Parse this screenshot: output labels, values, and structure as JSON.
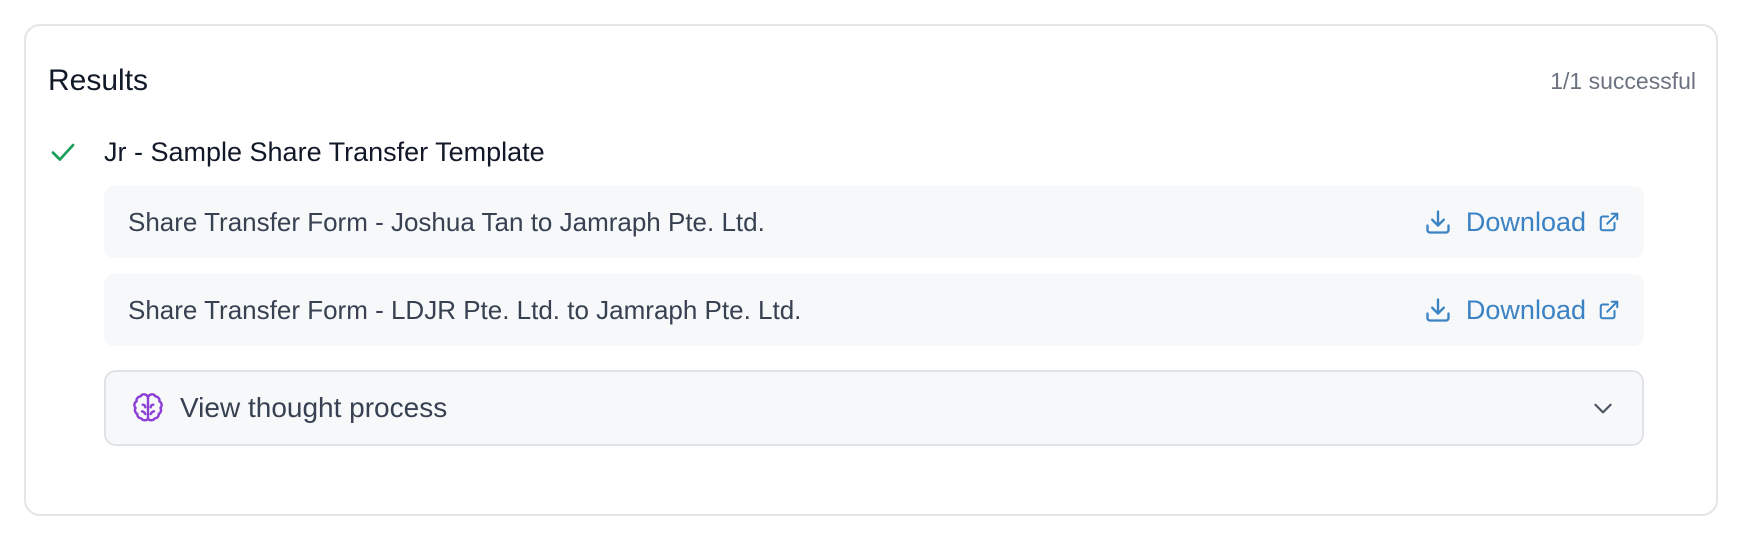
{
  "results": {
    "title": "Results",
    "count_text": "1/1 successful"
  },
  "template": {
    "name": "Jr - Sample Share Transfer Template",
    "status_icon": "check-icon",
    "status_color": "#1a9e5a"
  },
  "files": [
    {
      "name": "Share Transfer Form - Joshua Tan to Jamraph Pte. Ltd.",
      "action_label": "Download"
    },
    {
      "name": "Share Transfer Form - LDJR Pte. Ltd. to Jamraph Pte. Ltd.",
      "action_label": "Download"
    }
  ],
  "thought_process": {
    "label": "View thought process",
    "icon": "brain-icon",
    "icon_color": "#8b3fd6",
    "toggle_icon": "chevron-down-icon"
  },
  "colors": {
    "link": "#3b82c4",
    "success": "#1a9e5a"
  }
}
